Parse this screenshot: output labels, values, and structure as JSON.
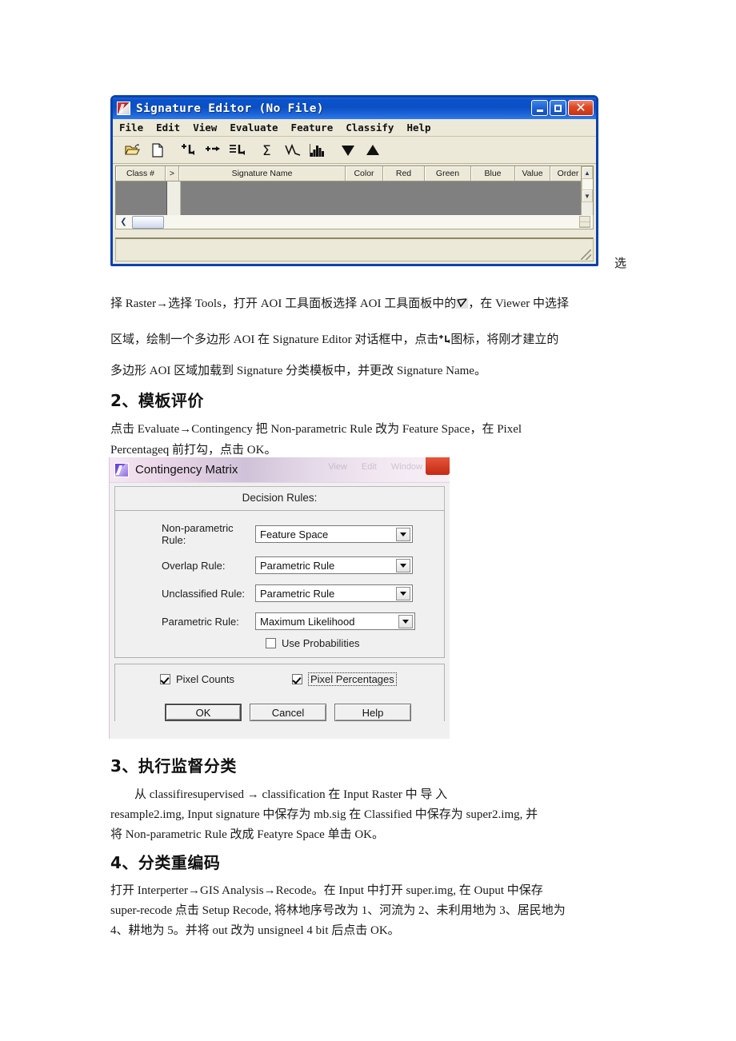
{
  "signature_editor": {
    "title": "Signature Editor  (No File)",
    "app_icon": "erdas-signature-icon",
    "window_buttons": {
      "minimize": "minimize-icon",
      "maximize": "maximize-icon",
      "close": "close-icon"
    },
    "menu": [
      "File",
      "Edit",
      "View",
      "Evaluate",
      "Feature",
      "Classify",
      "Help"
    ],
    "toolbar": [
      "open-folder-icon",
      "new-file-icon",
      "add-signature-icon",
      "merge-signature-icon",
      "replace-signature-icon",
      "statistics-sigma-icon",
      "mean-plot-icon",
      "histogram-icon",
      "move-down-icon",
      "move-up-icon"
    ],
    "columns": [
      "Class #",
      ">",
      "Signature Name",
      "Color",
      "Red",
      "Green",
      "Blue",
      "Value",
      "Order"
    ],
    "rows": []
  },
  "body": {
    "xuan_char": "选",
    "para1_pre": "择 Raster→选择 Tools，打开 AOI 工具面板选择 AOI 工具面板中的",
    "para1_icon": "aoi-polygon-icon",
    "para1_post": "，在 Viewer 中选择",
    "para2_pre": "区域，绘制一个多边形 AOI 在 Signature   Editor 对话框中，点击",
    "para2_icon": "add-signature-icon",
    "para2_post": "图标，将刚才建立的",
    "para3": "多边形 AOI 区域加载到 Signature 分类模板中，并更改 Signature   Name。",
    "heading2": "2、模板评价",
    "sect2_line1": "点击 Evaluate→Contingency 把 Non-parametric Rule 改为 Feature Space，在 Pixel",
    "sect2_line2": "Percentageq 前打勾，点击 OK。",
    "heading3": "3、执行监督分类",
    "sect3_line1": "　　从 classifiresupervised → classification 在 Input  Raster 中 导 入",
    "sect3_line2": "resample2.img, Input signature 中保存为 mb.sig 在 Classified 中保存为 super2.img, 并",
    "sect3_line3": "将 Non-parametric Rule 改成 Featyre Space 单击 OK。",
    "heading4": "4、分类重编码",
    "sect4_line1": "打开 Interperter→GIS Analysis→Recode。在 Input 中打开 super.img, 在 Ouput 中保存",
    "sect4_line2": "super-recode 点击 Setup Recode, 将林地序号改为 1、河流为 2、未利用地为 3、居民地为",
    "sect4_line3": "4、耕地为 5。并将 out 改为 unsigneel 4 bit 后点击 OK。"
  },
  "contingency_matrix": {
    "title": "Contingency Matrix",
    "app_icon": "erdas-matrix-icon",
    "close_button": "close-icon",
    "ghost_tabs": [
      "View",
      "Edit",
      "Window"
    ],
    "decision_rules_label": "Decision Rules:",
    "rules": [
      {
        "label": "Non-parametric Rule:",
        "value": "Feature Space"
      },
      {
        "label": "Overlap Rule:",
        "value": "Parametric Rule"
      },
      {
        "label": "Unclassified Rule:",
        "value": "Parametric Rule"
      },
      {
        "label": "Parametric Rule:",
        "value": "Maximum Likelihood"
      }
    ],
    "use_probabilities": {
      "label": "Use Probabilities",
      "checked": false
    },
    "pixel_counts": {
      "label": "Pixel Counts",
      "checked": true
    },
    "pixel_percentages": {
      "label": "Pixel Percentages",
      "checked": true
    },
    "buttons": [
      "OK",
      "Cancel",
      "Help"
    ],
    "accent_title_color": "#ddcfe0",
    "close_color": "#c42a14"
  }
}
